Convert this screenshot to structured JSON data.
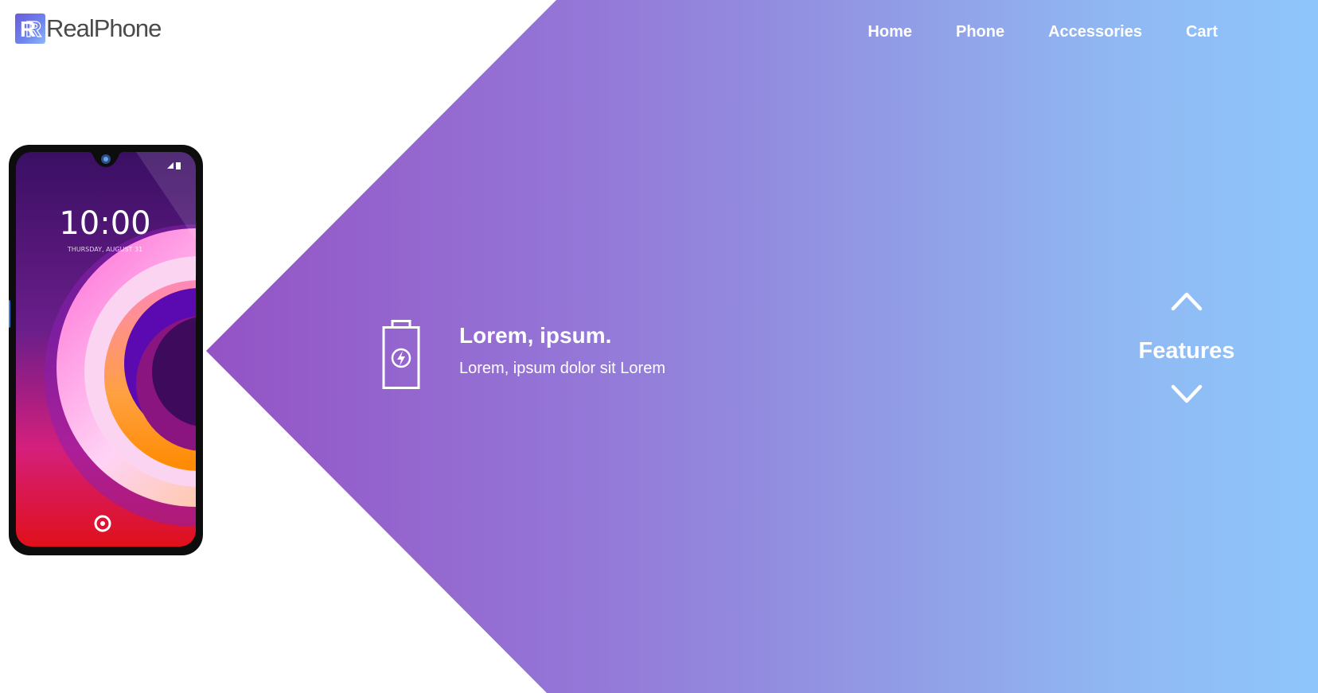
{
  "brand": {
    "name": "RealPhone",
    "logo_letter": "R",
    "accent_gradient": [
      "#9452c4",
      "#8ec6fb"
    ]
  },
  "nav": {
    "items": [
      {
        "label": "Home"
      },
      {
        "label": "Phone"
      },
      {
        "label": "Accessories"
      },
      {
        "label": "Cart"
      }
    ]
  },
  "phone_screen": {
    "time": "10:00",
    "date": "THURSDAY, AUGUST 31"
  },
  "feature": {
    "icon": "battery-charging-icon",
    "title": "Lorem, ipsum.",
    "description": "Lorem, ipsum dolor sit Lorem"
  },
  "switcher": {
    "label": "Features",
    "prev_icon": "chevron-up-icon",
    "next_icon": "chevron-down-icon"
  }
}
